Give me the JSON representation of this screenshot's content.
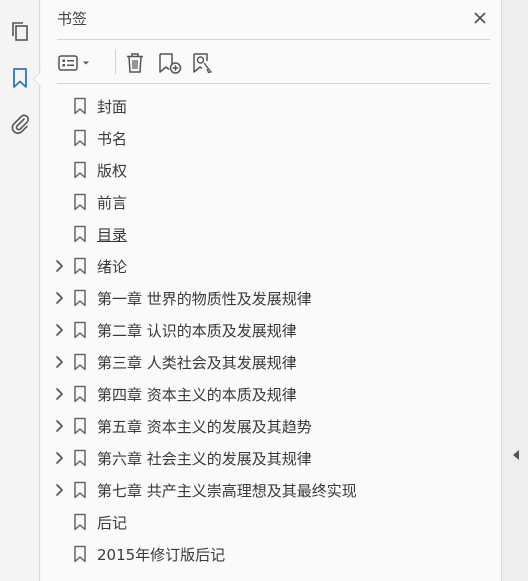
{
  "panel": {
    "title": "书签"
  },
  "rail": {
    "items": [
      {
        "icon": "pages-icon",
        "active": false
      },
      {
        "icon": "bookmark-icon",
        "active": true
      },
      {
        "icon": "attachment-icon",
        "active": false
      }
    ]
  },
  "toolbar": {
    "buttons": [
      "options-menu-icon",
      "delete-icon",
      "new-bookmark-icon",
      "bookmark-find-icon"
    ]
  },
  "bookmarks": [
    {
      "label": "封面",
      "expandable": false,
      "underline": false
    },
    {
      "label": "书名",
      "expandable": false,
      "underline": false
    },
    {
      "label": "版权",
      "expandable": false,
      "underline": false
    },
    {
      "label": "前言",
      "expandable": false,
      "underline": false
    },
    {
      "label": "目录",
      "expandable": false,
      "underline": true
    },
    {
      "label": "绪论",
      "expandable": true,
      "underline": false
    },
    {
      "label": "第一章  世界的物质性及发展规律",
      "expandable": true,
      "underline": false
    },
    {
      "label": "第二章  认识的本质及发展规律",
      "expandable": true,
      "underline": false
    },
    {
      "label": "第三章  人类社会及其发展规律",
      "expandable": true,
      "underline": false
    },
    {
      "label": "第四章  资本主义的本质及规律",
      "expandable": true,
      "underline": false
    },
    {
      "label": "第五章  资本主义的发展及其趋势",
      "expandable": true,
      "underline": false
    },
    {
      "label": "第六章  社会主义的发展及其规律",
      "expandable": true,
      "underline": false
    },
    {
      "label": "第七章  共产主义崇高理想及其最终实现",
      "expandable": true,
      "underline": false
    },
    {
      "label": "后记",
      "expandable": false,
      "underline": false
    },
    {
      "label": "2015年修订版后记",
      "expandable": false,
      "underline": false
    }
  ],
  "colors": {
    "accent": "#2d73d0",
    "icon": "#555555"
  }
}
